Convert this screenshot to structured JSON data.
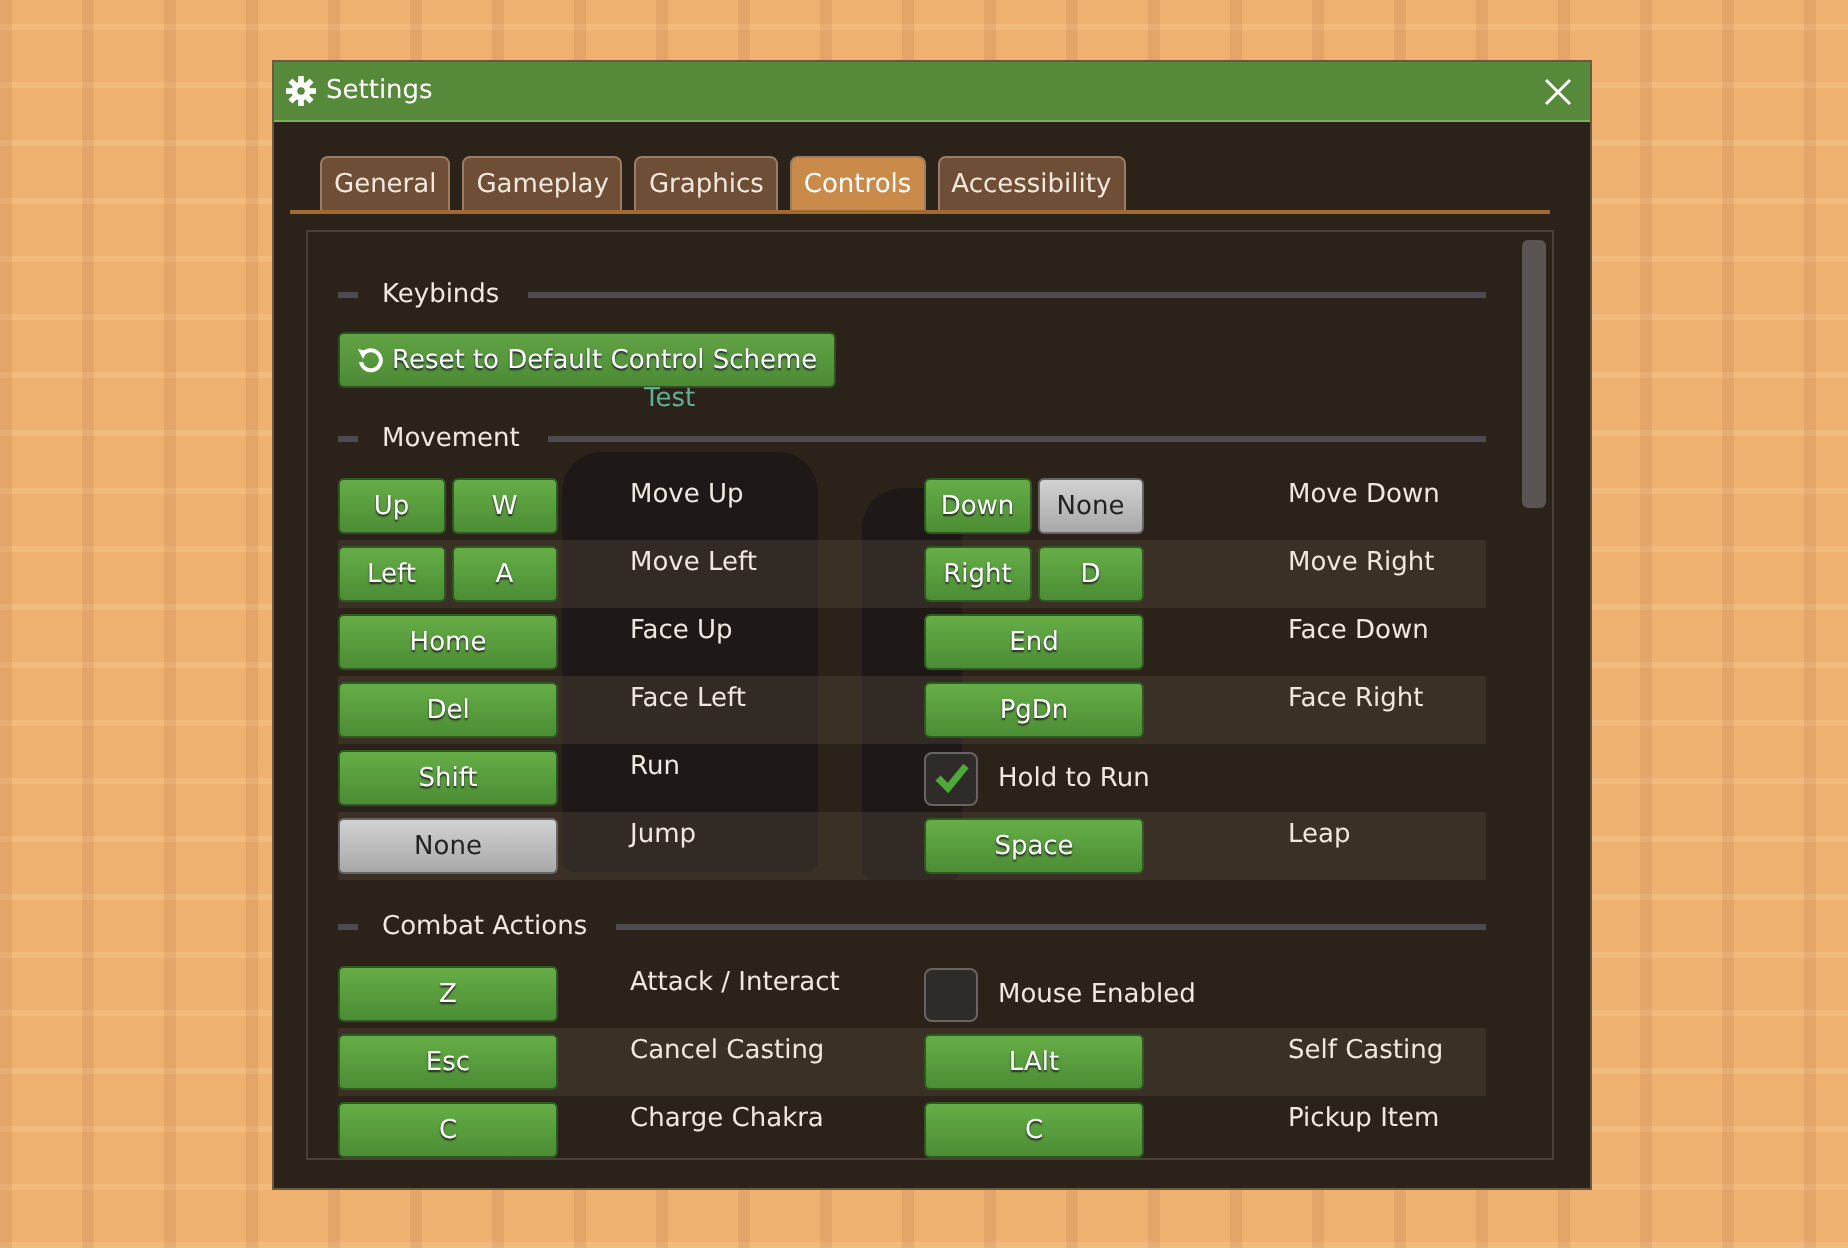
{
  "window": {
    "title": "Settings"
  },
  "tabs": [
    {
      "label": "General",
      "selected": false
    },
    {
      "label": "Gameplay",
      "selected": false
    },
    {
      "label": "Graphics",
      "selected": false
    },
    {
      "label": "Controls",
      "selected": true
    },
    {
      "label": "Accessibility",
      "selected": false
    }
  ],
  "sections": [
    {
      "title": "Keybinds",
      "kind": "actions",
      "button": "Reset to Default Control Scheme"
    },
    {
      "title": "Movement",
      "kind": "binds",
      "preview_label": "Test",
      "rows": [
        {
          "left": {
            "kind": "keys",
            "keys": [
              {
                "label": "Up",
                "bound": true
              },
              {
                "label": "W",
                "bound": true
              }
            ],
            "action": "Move Up"
          },
          "right": {
            "kind": "keys",
            "keys": [
              {
                "label": "Down",
                "bound": true
              },
              {
                "label": "None",
                "bound": false
              }
            ],
            "action": "Move Down"
          }
        },
        {
          "left": {
            "kind": "keys",
            "keys": [
              {
                "label": "Left",
                "bound": true
              },
              {
                "label": "A",
                "bound": true
              }
            ],
            "action": "Move Left"
          },
          "right": {
            "kind": "keys",
            "keys": [
              {
                "label": "Right",
                "bound": true
              },
              {
                "label": "D",
                "bound": true
              }
            ],
            "action": "Move Right"
          }
        },
        {
          "left": {
            "kind": "keys",
            "keys": [
              {
                "label": "Home",
                "bound": true
              }
            ],
            "action": "Face Up"
          },
          "right": {
            "kind": "keys",
            "keys": [
              {
                "label": "End",
                "bound": true
              }
            ],
            "action": "Face Down"
          }
        },
        {
          "left": {
            "kind": "keys",
            "keys": [
              {
                "label": "Del",
                "bound": true
              }
            ],
            "action": "Face Left"
          },
          "right": {
            "kind": "keys",
            "keys": [
              {
                "label": "PgDn",
                "bound": true
              }
            ],
            "action": "Face Right"
          }
        },
        {
          "left": {
            "kind": "keys",
            "keys": [
              {
                "label": "Shift",
                "bound": true
              }
            ],
            "action": "Run"
          },
          "right": {
            "kind": "toggle",
            "label": "Hold to Run",
            "checked": true
          }
        },
        {
          "left": {
            "kind": "keys",
            "keys": [
              {
                "label": "None",
                "bound": false
              }
            ],
            "action": "Jump"
          },
          "right": {
            "kind": "keys",
            "keys": [
              {
                "label": "Space",
                "bound": true
              }
            ],
            "action": "Leap"
          }
        }
      ]
    },
    {
      "title": "Combat Actions",
      "kind": "binds",
      "rows": [
        {
          "left": {
            "kind": "keys",
            "keys": [
              {
                "label": "Z",
                "bound": true
              }
            ],
            "action": "Attack / Interact"
          },
          "right": {
            "kind": "toggle",
            "label": "Mouse Enabled",
            "checked": false
          }
        },
        {
          "left": {
            "kind": "keys",
            "keys": [
              {
                "label": "Esc",
                "bound": true
              }
            ],
            "action": "Cancel Casting"
          },
          "right": {
            "kind": "keys",
            "keys": [
              {
                "label": "LAlt",
                "bound": true
              }
            ],
            "action": "Self Casting"
          }
        },
        {
          "left": {
            "kind": "keys",
            "keys": [
              {
                "label": "C",
                "bound": true
              }
            ],
            "action": "Charge Chakra"
          },
          "right": {
            "kind": "keys",
            "keys": [
              {
                "label": "C",
                "bound": true
              }
            ],
            "action": "Pickup Item"
          }
        }
      ]
    }
  ]
}
